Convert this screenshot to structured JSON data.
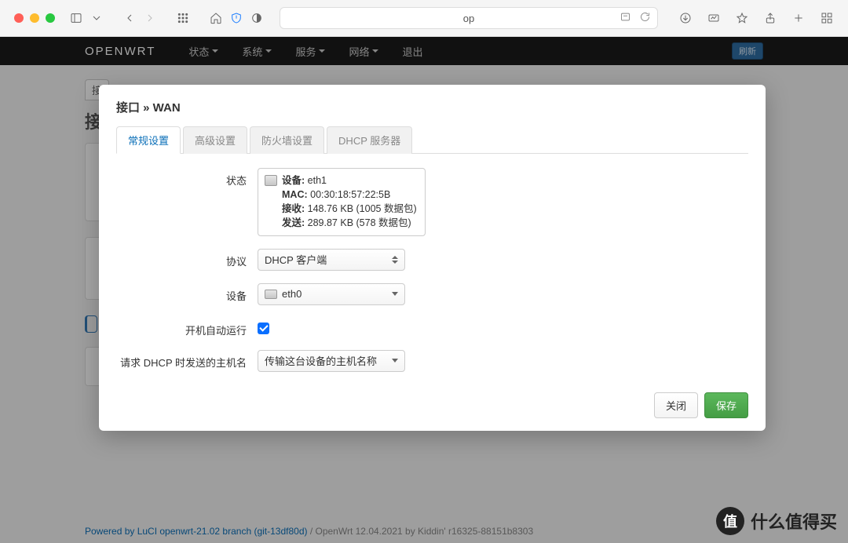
{
  "browser": {
    "url_display": "op"
  },
  "nav": {
    "brand": "OPENWRT",
    "menu": [
      {
        "label": "状态",
        "dropdown": true
      },
      {
        "label": "系统",
        "dropdown": true
      },
      {
        "label": "服务",
        "dropdown": true
      },
      {
        "label": "网络",
        "dropdown": true
      },
      {
        "label": "退出",
        "dropdown": false
      }
    ],
    "refresh": "刷新"
  },
  "page": {
    "h1": "接"
  },
  "modal": {
    "title": "接口 » WAN",
    "tabs": [
      "常规设置",
      "高级设置",
      "防火墙设置",
      "DHCP 服务器"
    ],
    "active_tab": 0,
    "labels": {
      "status": "状态",
      "protocol": "协议",
      "device": "设备",
      "autostart": "开机自动运行",
      "hostname": "请求 DHCP 时发送的主机名"
    },
    "status": {
      "device_label": "设备:",
      "device_value": "eth1",
      "mac_label": "MAC:",
      "mac_value": "00:30:18:57:22:5B",
      "rx_label": "接收:",
      "rx_value": "148.76 KB (1005 数据包)",
      "tx_label": "发送:",
      "tx_value": "289.87 KB (578 数据包)"
    },
    "protocol_value": "DHCP 客户端",
    "device_value": "eth0",
    "autostart_checked": true,
    "hostname_value": "传输这台设备的主机名称",
    "buttons": {
      "close": "关闭",
      "save": "保存"
    }
  },
  "footer": {
    "link": "Powered by LuCI openwrt-21.02 branch (git-13df80d)",
    "rest": " / OpenWrt 12.04.2021 by Kiddin' r16325-88151b8303"
  },
  "watermark": {
    "badge": "值",
    "text": "什么值得买"
  }
}
